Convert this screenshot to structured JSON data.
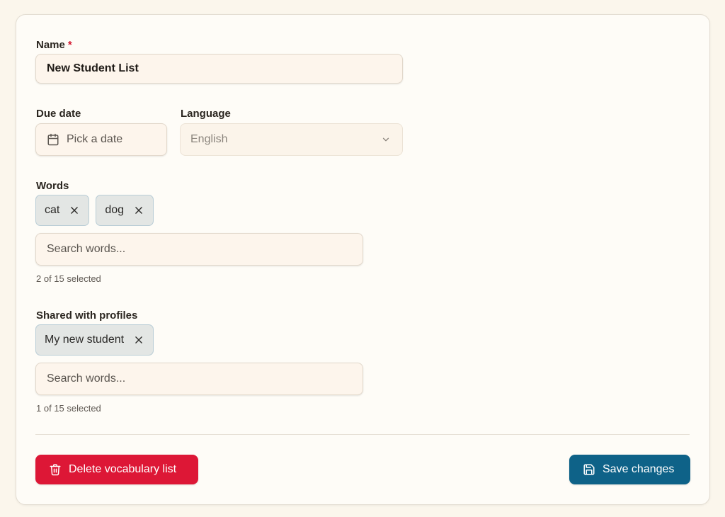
{
  "form": {
    "name": {
      "label": "Name",
      "required_mark": "*",
      "value": "New Student List"
    },
    "due_date": {
      "label": "Due date",
      "button_label": "Pick a date",
      "icon": "calendar-icon"
    },
    "language": {
      "label": "Language",
      "selected": "English",
      "icon": "chevron-down-icon"
    },
    "words": {
      "label": "Words",
      "chips": [
        {
          "label": "cat"
        },
        {
          "label": "dog"
        }
      ],
      "search_placeholder": "Search words...",
      "helper": "2 of 15 selected"
    },
    "shared": {
      "label": "Shared with profiles",
      "chips": [
        {
          "label": "My new student"
        }
      ],
      "search_placeholder": "Search words...",
      "helper": "1 of 15 selected"
    }
  },
  "actions": {
    "delete_label": "Delete vocabulary list",
    "delete_icon": "trash-icon",
    "save_label": "Save changes",
    "save_icon": "save-icon"
  },
  "colors": {
    "page_bg": "#fbf6ec",
    "card_bg": "#fefcf7",
    "chip_bg": "#e3e6e4",
    "chip_border": "#b9cdd6",
    "danger": "#dd1736",
    "primary": "#0e6288",
    "required": "#d3162f"
  }
}
